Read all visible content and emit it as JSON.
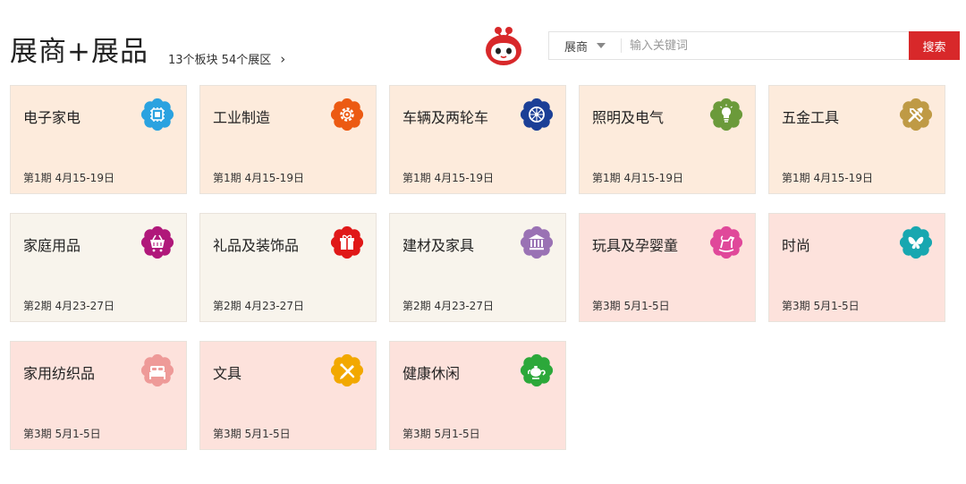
{
  "header": {
    "title": "展商+展品",
    "summary": "13个板块 54个展区",
    "chevron": "›"
  },
  "search": {
    "scope": "展商",
    "placeholder": "输入关键词",
    "button": "搜索"
  },
  "colors": {
    "accent": "#d8282a",
    "phase1_bg": "#fdebdc",
    "phase2_bg": "#f8f4ec",
    "phase3_bg": "#fde2dc"
  },
  "cards": [
    {
      "name": "电子家电",
      "date": "第1期 4月15-19日",
      "bg": "#fdebdc",
      "icon_color": "#2aa2e0",
      "icon": "chip-icon"
    },
    {
      "name": "工业制造",
      "date": "第1期 4月15-19日",
      "bg": "#fdebdc",
      "icon_color": "#ec5a12",
      "icon": "gear-icon"
    },
    {
      "name": "车辆及两轮车",
      "date": "第1期 4月15-19日",
      "bg": "#fdebdc",
      "icon_color": "#1b3f96",
      "icon": "wheel-icon"
    },
    {
      "name": "照明及电气",
      "date": "第1期 4月15-19日",
      "bg": "#fdebdc",
      "icon_color": "#6b9a3a",
      "icon": "bulb-icon"
    },
    {
      "name": "五金工具",
      "date": "第1期 4月15-19日",
      "bg": "#fdebdc",
      "icon_color": "#bf9a45",
      "icon": "tools-icon"
    },
    {
      "name": "家庭用品",
      "date": "第2期 4月23-27日",
      "bg": "#f8f4ec",
      "icon_color": "#b0187a",
      "icon": "basket-icon"
    },
    {
      "name": "礼品及装饰品",
      "date": "第2期 4月23-27日",
      "bg": "#f8f4ec",
      "icon_color": "#e01818",
      "icon": "gift-icon"
    },
    {
      "name": "建材及家具",
      "date": "第2期 4月23-27日",
      "bg": "#f8f4ec",
      "icon_color": "#9a72b4",
      "icon": "building-icon"
    },
    {
      "name": "玩具及孕婴童",
      "date": "第3期 5月1-5日",
      "bg": "#fde2dc",
      "icon_color": "#e0489a",
      "icon": "rocking-horse-icon"
    },
    {
      "name": "时尚",
      "date": "第3期 5月1-5日",
      "bg": "#fde2dc",
      "icon_color": "#18a7b0",
      "icon": "butterfly-icon"
    },
    {
      "name": "家用纺织品",
      "date": "第3期 5月1-5日",
      "bg": "#fde2dc",
      "icon_color": "#ee9a98",
      "icon": "bed-icon"
    },
    {
      "name": "文具",
      "date": "第3期 5月1-5日",
      "bg": "#fde2dc",
      "icon_color": "#f2a800",
      "icon": "pencil-icon"
    },
    {
      "name": "健康休闲",
      "date": "第3期 5月1-5日",
      "bg": "#fde2dc",
      "icon_color": "#2ca83a",
      "icon": "teapot-icon"
    }
  ]
}
